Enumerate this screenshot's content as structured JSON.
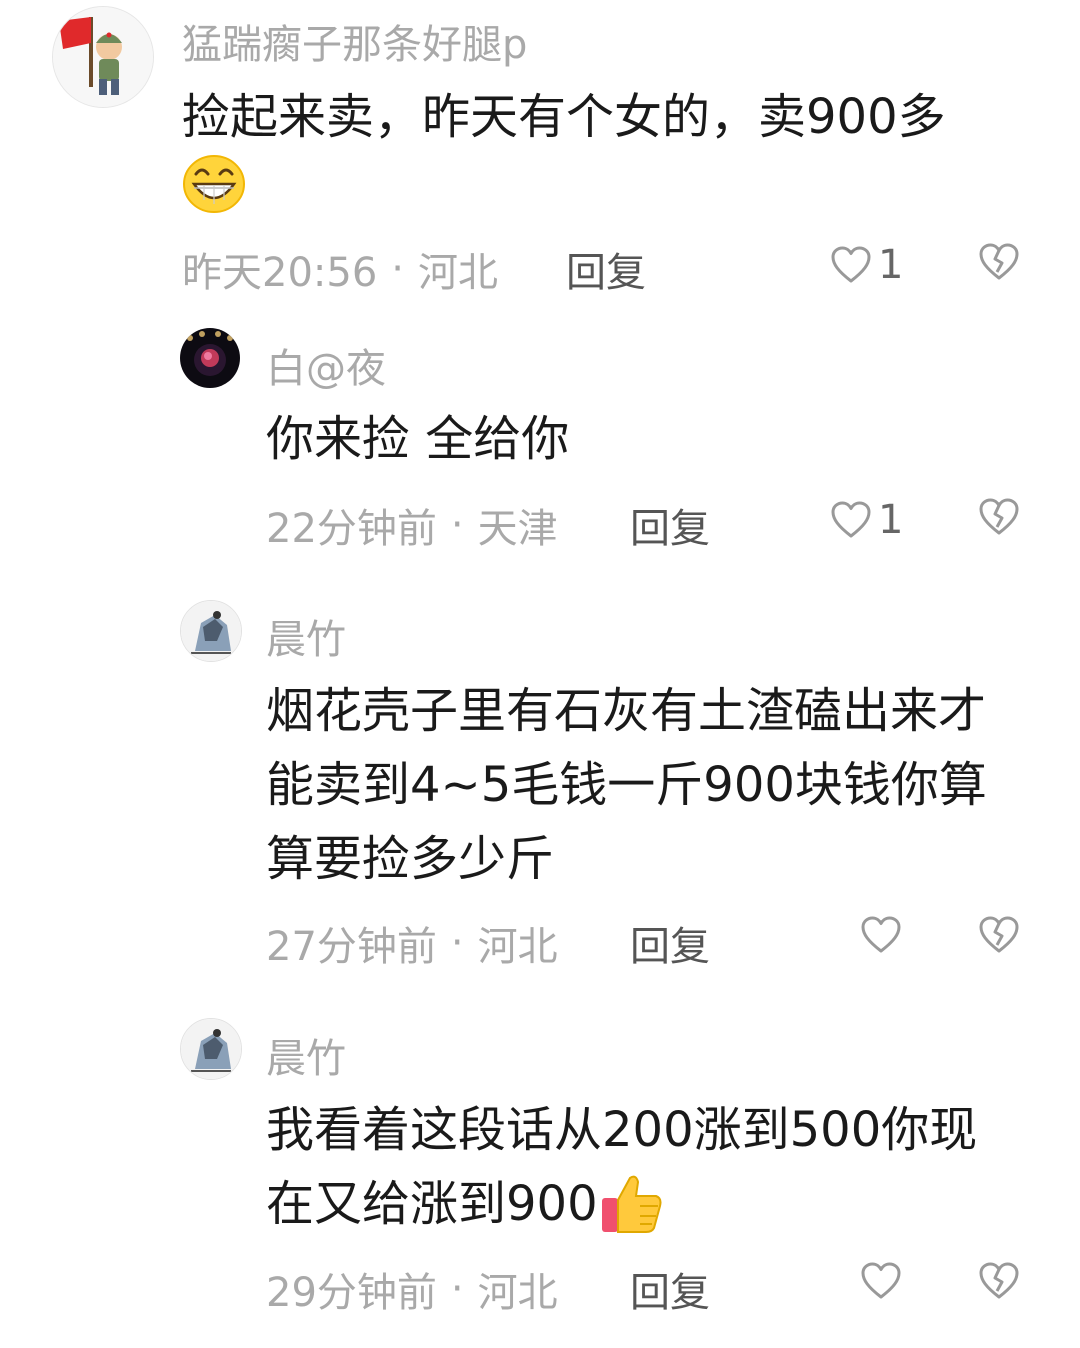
{
  "comments": [
    {
      "username": "猛踹瘸子那条好腿p",
      "text_line1": "捡起来卖，昨天有个女的，卖900多",
      "emoji": "grinning-face",
      "time": "昨天20:56",
      "location": "河北",
      "reply_label": "回复",
      "like_count": "1"
    },
    {
      "username": "白@夜",
      "text": "你来捡 全给你",
      "time": "22分钟前",
      "location": "天津",
      "reply_label": "回复",
      "like_count": "1"
    },
    {
      "username": "晨竹",
      "text_line1": "烟花壳子里有石灰有土渣磕出来才",
      "text_line2": "能卖到4~5毛钱一斤900块钱你算",
      "text_line3": "算要捡多少斤",
      "time": "27分钟前",
      "location": "河北",
      "reply_label": "回复"
    },
    {
      "username": "晨竹",
      "text_line1": "我看着这段话从200涨到500你现",
      "text_line2": "在又给涨到900",
      "emoji": "thumbs-up",
      "time": "29分钟前",
      "location": "河北",
      "reply_label": "回复"
    }
  ],
  "meta_separator": "·",
  "colors": {
    "username": "#a9a9a9",
    "text": "#1a1a1a",
    "meta": "#a9a9a9",
    "reply": "#555555",
    "icon_stroke": "#999999"
  }
}
